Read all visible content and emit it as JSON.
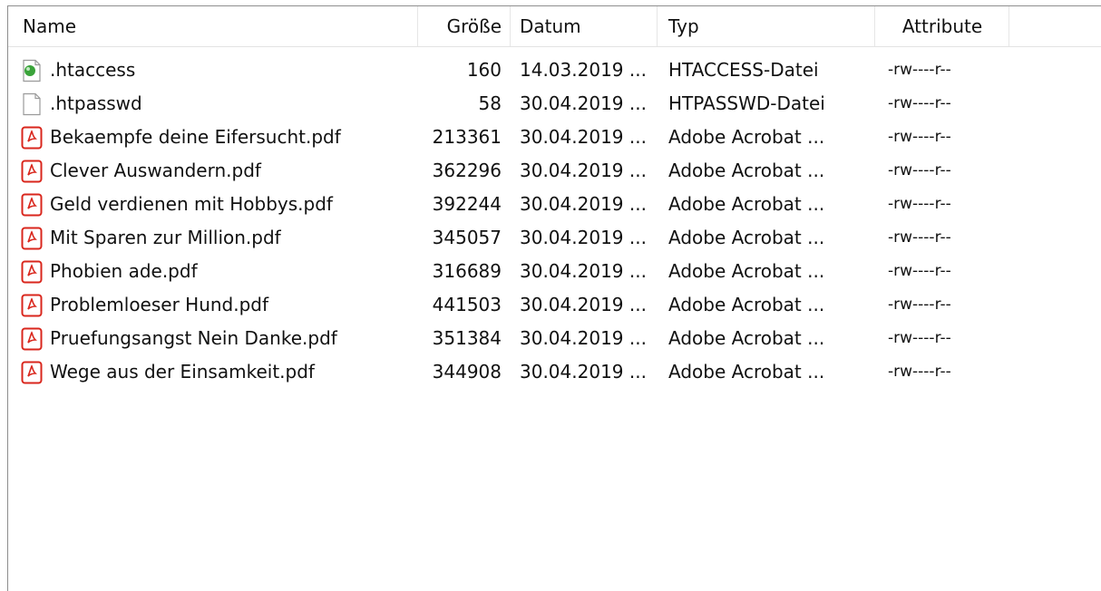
{
  "columns": {
    "name": "Name",
    "size": "Größe",
    "date": "Datum",
    "type": "Typ",
    "attributes": "Attribute"
  },
  "files": [
    {
      "icon": "htaccess-file-icon",
      "name": ".htaccess",
      "size": "160",
      "date": "14.03.2019 ...",
      "type": "HTACCESS-Datei",
      "attributes": "-rw----r--"
    },
    {
      "icon": "blank-file-icon",
      "name": ".htpasswd",
      "size": "58",
      "date": "30.04.2019 ...",
      "type": "HTPASSWD-Datei",
      "attributes": "-rw----r--"
    },
    {
      "icon": "pdf-file-icon",
      "name": "Bekaempfe deine Eifersucht.pdf",
      "size": "213361",
      "date": "30.04.2019 ...",
      "type": "Adobe Acrobat ...",
      "attributes": "-rw----r--"
    },
    {
      "icon": "pdf-file-icon",
      "name": "Clever Auswandern.pdf",
      "size": "362296",
      "date": "30.04.2019 ...",
      "type": "Adobe Acrobat ...",
      "attributes": "-rw----r--"
    },
    {
      "icon": "pdf-file-icon",
      "name": "Geld verdienen mit Hobbys.pdf",
      "size": "392244",
      "date": "30.04.2019 ...",
      "type": "Adobe Acrobat ...",
      "attributes": "-rw----r--"
    },
    {
      "icon": "pdf-file-icon",
      "name": "Mit Sparen zur Million.pdf",
      "size": "345057",
      "date": "30.04.2019 ...",
      "type": "Adobe Acrobat ...",
      "attributes": "-rw----r--"
    },
    {
      "icon": "pdf-file-icon",
      "name": "Phobien ade.pdf",
      "size": "316689",
      "date": "30.04.2019 ...",
      "type": "Adobe Acrobat ...",
      "attributes": "-rw----r--"
    },
    {
      "icon": "pdf-file-icon",
      "name": "Problemloeser Hund.pdf",
      "size": "441503",
      "date": "30.04.2019 ...",
      "type": "Adobe Acrobat ...",
      "attributes": "-rw----r--"
    },
    {
      "icon": "pdf-file-icon",
      "name": "Pruefungsangst Nein Danke.pdf",
      "size": "351384",
      "date": "30.04.2019 ...",
      "type": "Adobe Acrobat ...",
      "attributes": "-rw----r--"
    },
    {
      "icon": "pdf-file-icon",
      "name": "Wege aus der Einsamkeit.pdf",
      "size": "344908",
      "date": "30.04.2019 ...",
      "type": "Adobe Acrobat ...",
      "attributes": "-rw----r--"
    }
  ],
  "colors": {
    "pdf_red": "#d9261c",
    "htaccess_green": "#3aa33a",
    "border": "#8e8e8e"
  }
}
